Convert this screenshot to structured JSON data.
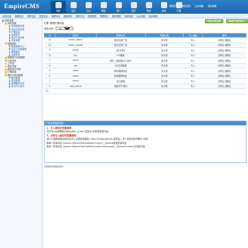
{
  "app": {
    "logo_main": "EmpireCMS",
    "logo_sub": "",
    "top_links": [
      "管理首页",
      "网站首页",
      "后台地图",
      "退出管理"
    ]
  },
  "top_nav": [
    {
      "label": "系统",
      "icon": "system-icon",
      "active": true
    },
    {
      "label": "信息",
      "icon": "info-icon",
      "active": false
    },
    {
      "label": "栏目",
      "icon": "column-icon",
      "active": false
    },
    {
      "label": "模板",
      "icon": "template-icon",
      "active": false
    },
    {
      "label": "用户",
      "icon": "user-icon",
      "active": false
    },
    {
      "label": "插件",
      "icon": "plugin-icon",
      "active": false
    },
    {
      "label": "商城",
      "icon": "shop-icon",
      "active": false
    },
    {
      "label": "其他",
      "icon": "other-icon",
      "active": false
    },
    {
      "label": "扩展",
      "icon": "extend-icon",
      "active": false
    }
  ],
  "menu_bar": [
    "增加信息",
    "管理信息",
    "审核信息",
    "签发信息",
    "管理评论",
    "更新首页",
    "更新栏目",
    "数据更新",
    "数据统计",
    "备份数据",
    "系统参数",
    "后台地图",
    "退出管理"
  ],
  "sidebar": [
    {
      "label": "系统设置",
      "level": 1,
      "kind": "box"
    },
    {
      "label": "系统设置",
      "level": 2,
      "kind": "folder"
    },
    {
      "label": "系统参数设置",
      "level": 3,
      "kind": "page"
    },
    {
      "label": "信息存放目录",
      "level": 3,
      "kind": "page"
    },
    {
      "label": "扩展变量",
      "level": 3,
      "kind": "page"
    },
    {
      "label": "远程发布",
      "level": 3,
      "kind": "page"
    },
    {
      "label": "首页方案设置",
      "level": 3,
      "kind": "page"
    },
    {
      "label": "网站地图",
      "level": 3,
      "kind": "page"
    },
    {
      "label": "数据更新",
      "level": 2,
      "kind": "folder"
    },
    {
      "label": "数据更新中心",
      "level": 3,
      "kind": "page"
    },
    {
      "label": "自定义页面管理",
      "level": 3,
      "kind": "page"
    },
    {
      "label": "更新缓存",
      "level": 3,
      "kind": "page"
    },
    {
      "label": "远程发布",
      "level": 3,
      "kind": "page"
    },
    {
      "label": "数据表与系统模型",
      "level": 2,
      "kind": "folder"
    },
    {
      "label": "计划任务",
      "level": 2,
      "kind": "folder"
    },
    {
      "label": "工作流",
      "level": 2,
      "kind": "folder"
    },
    {
      "label": "优化方案",
      "level": 2,
      "kind": "folder"
    },
    {
      "label": "网站多访问端",
      "level": 2,
      "kind": "folder"
    },
    {
      "label": "扩展菜单",
      "level": 2,
      "kind": "folder"
    },
    {
      "label": "备份与恢复数据",
      "level": 2,
      "kind": "folder"
    },
    {
      "label": "备份数据",
      "level": 3,
      "kind": "page"
    },
    {
      "label": "恢复数据",
      "level": 3,
      "kind": "page"
    },
    {
      "label": "管理备份目录",
      "level": 3,
      "kind": "page"
    },
    {
      "label": "执行SQL语句",
      "level": 3,
      "kind": "page"
    }
  ],
  "main": {
    "breadcrumb": "位置: 管理扩展变量",
    "add_button": "增加扩展变量",
    "manage_button": "管理扩展变量分类",
    "filter_label": "选择分类:",
    "filter_value": "显示所有分类",
    "columns": [
      "ID",
      "变量名",
      "变量标识",
      "所属分类",
      "写入缓存",
      "操作"
    ],
    "rows": [
      {
        "id": "11",
        "name": "home_dead1",
        "desc": "首页右侧广告",
        "cat": "未分类",
        "cache": "写入",
        "ops": "[修改] [删除]"
      },
      {
        "id": "10",
        "name": "home_dead0",
        "desc": "首页左侧广告",
        "cat": "未分类",
        "cache": "写入",
        "ops": "[修改] [删除]"
      },
      {
        "id": "9",
        "name": "tongji",
        "desc": "统计代码",
        "cat": "未分类",
        "cache": "写入",
        "ops": "[修改] [删除]"
      },
      {
        "id": "8",
        "name": "icp",
        "desc": "ICP备案",
        "cat": "未分类",
        "cache": "写入",
        "ops": "[修改] [删除]"
      },
      {
        "id": "7",
        "name": "seotit",
        "desc": "首页二级标题SEO优化",
        "cat": "未分类",
        "cache": "写入",
        "ops": "[修改] [删除]"
      },
      {
        "id": "6",
        "name": "qq",
        "desc": "QQ在线客服",
        "cat": "未分类",
        "cache": "写入",
        "ops": "[修改] [删除]"
      },
      {
        "id": "5",
        "name": "tewb",
        "desc": "腾讯微博地址",
        "cat": "未分类",
        "cache": "写入",
        "ops": "[修改] [删除]"
      },
      {
        "id": "4",
        "name": "sewb",
        "desc": "新浪微博地址",
        "cat": "未分类",
        "cache": "写入",
        "ops": "[修改] [删除]"
      },
      {
        "id": "3",
        "name": "email",
        "desc": "站长邮箱",
        "cat": "未分类",
        "cache": "写入",
        "ops": "[修改] [删除]"
      },
      {
        "id": "2",
        "name": "foot_about",
        "desc": "底部关于我们",
        "cat": "未分类",
        "cache": "写入",
        "ops": "[修改] [删除]"
      }
    ],
    "total": "10"
  },
  "notes": {
    "title": "扩展变量调用说明",
    "section1": "1、写入缓存的变量调用",
    "line1": "在任意php或模板中用$public_r['add_变量名']可获得变量内容。",
    "section2": "2、没有写入缓存的变量调用",
    "line2": "用以下函数读取变量内容(可以设置是否缓存): ReturnPublicAddVar(变量名), 多个变量用逗号隔开, 例如:",
    "line3": "取单个变量内容: $value=ReturnPublicAddVar('name'); //$value就是变量内容",
    "line4": "取多个变量内容: $value=ReturnPublicAddVar('name,title,email'); //$value['name']为变量内容"
  },
  "watermark": "www.rrbig.com"
}
